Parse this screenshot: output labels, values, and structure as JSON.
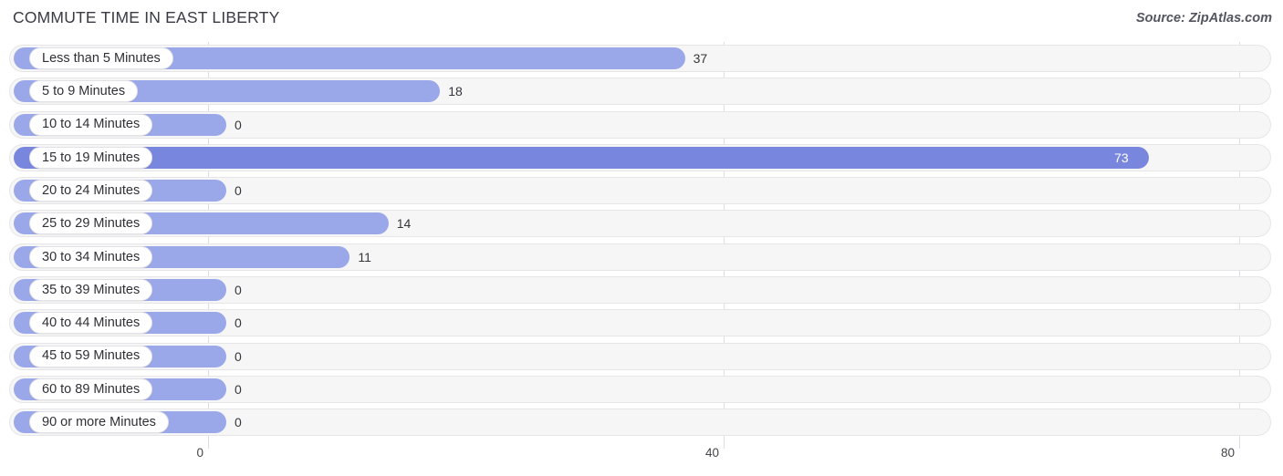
{
  "header": {
    "title": "COMMUTE TIME IN EAST LIBERTY",
    "source": "Source: ZipAtlas.com"
  },
  "colors": {
    "bar": "#9aa7e8",
    "bar_max": "#7986dd",
    "track": "#f6f6f6",
    "track_border": "#e6e6e8",
    "gridline": "#dddde0",
    "text": "#2f2f35"
  },
  "chart_data": {
    "type": "bar",
    "orientation": "horizontal",
    "title": "COMMUTE TIME IN EAST LIBERTY",
    "xlabel": "",
    "ylabel": "",
    "xlim": [
      0,
      80
    ],
    "xticks": [
      0,
      40,
      80
    ],
    "xtick_labels": [
      "0",
      "40",
      "80"
    ],
    "grid": true,
    "legend": false,
    "source": "Source: ZipAtlas.com",
    "highlight_rule": "maximum value drawn in darker blue with white inline label",
    "categories": [
      "Less than 5 Minutes",
      "5 to 9 Minutes",
      "10 to 14 Minutes",
      "15 to 19 Minutes",
      "20 to 24 Minutes",
      "25 to 29 Minutes",
      "30 to 34 Minutes",
      "35 to 39 Minutes",
      "40 to 44 Minutes",
      "45 to 59 Minutes",
      "60 to 89 Minutes",
      "90 or more Minutes"
    ],
    "values": [
      37,
      18,
      0,
      73,
      0,
      14,
      11,
      0,
      0,
      0,
      0,
      0
    ],
    "value_labels": [
      "37",
      "18",
      "0",
      "73",
      "0",
      "14",
      "11",
      "0",
      "0",
      "0",
      "0",
      "0"
    ]
  }
}
